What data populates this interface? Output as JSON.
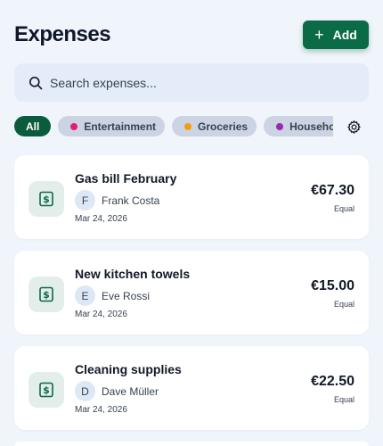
{
  "header": {
    "title": "Expenses",
    "add_label": "Add"
  },
  "search": {
    "placeholder": "Search expenses..."
  },
  "filters": [
    {
      "label": "All",
      "active": true
    },
    {
      "label": "Entertainment",
      "dot_color": "#e11d74"
    },
    {
      "label": "Groceries",
      "dot_color": "#f59e0b"
    },
    {
      "label": "Household",
      "dot_color": "#9c27b0"
    }
  ],
  "colors": {
    "accent": "#0b6b47",
    "background": "#f0f4fb"
  },
  "expenses": [
    {
      "title": "Gas bill February",
      "initial": "F",
      "payer": "Frank Costa",
      "date": "Mar 24, 2026",
      "amount": "€67.30",
      "split": "Equal",
      "icon": "receipt-icon"
    },
    {
      "title": "New kitchen towels",
      "initial": "E",
      "payer": "Eve Rossi",
      "date": "Mar 24, 2026",
      "amount": "€15.00",
      "split": "Equal",
      "icon": "receipt-icon"
    },
    {
      "title": "Cleaning supplies",
      "initial": "D",
      "payer": "Dave Müller",
      "date": "Mar 24, 2026",
      "amount": "€22.50",
      "split": "Equal",
      "icon": "receipt-icon"
    }
  ]
}
